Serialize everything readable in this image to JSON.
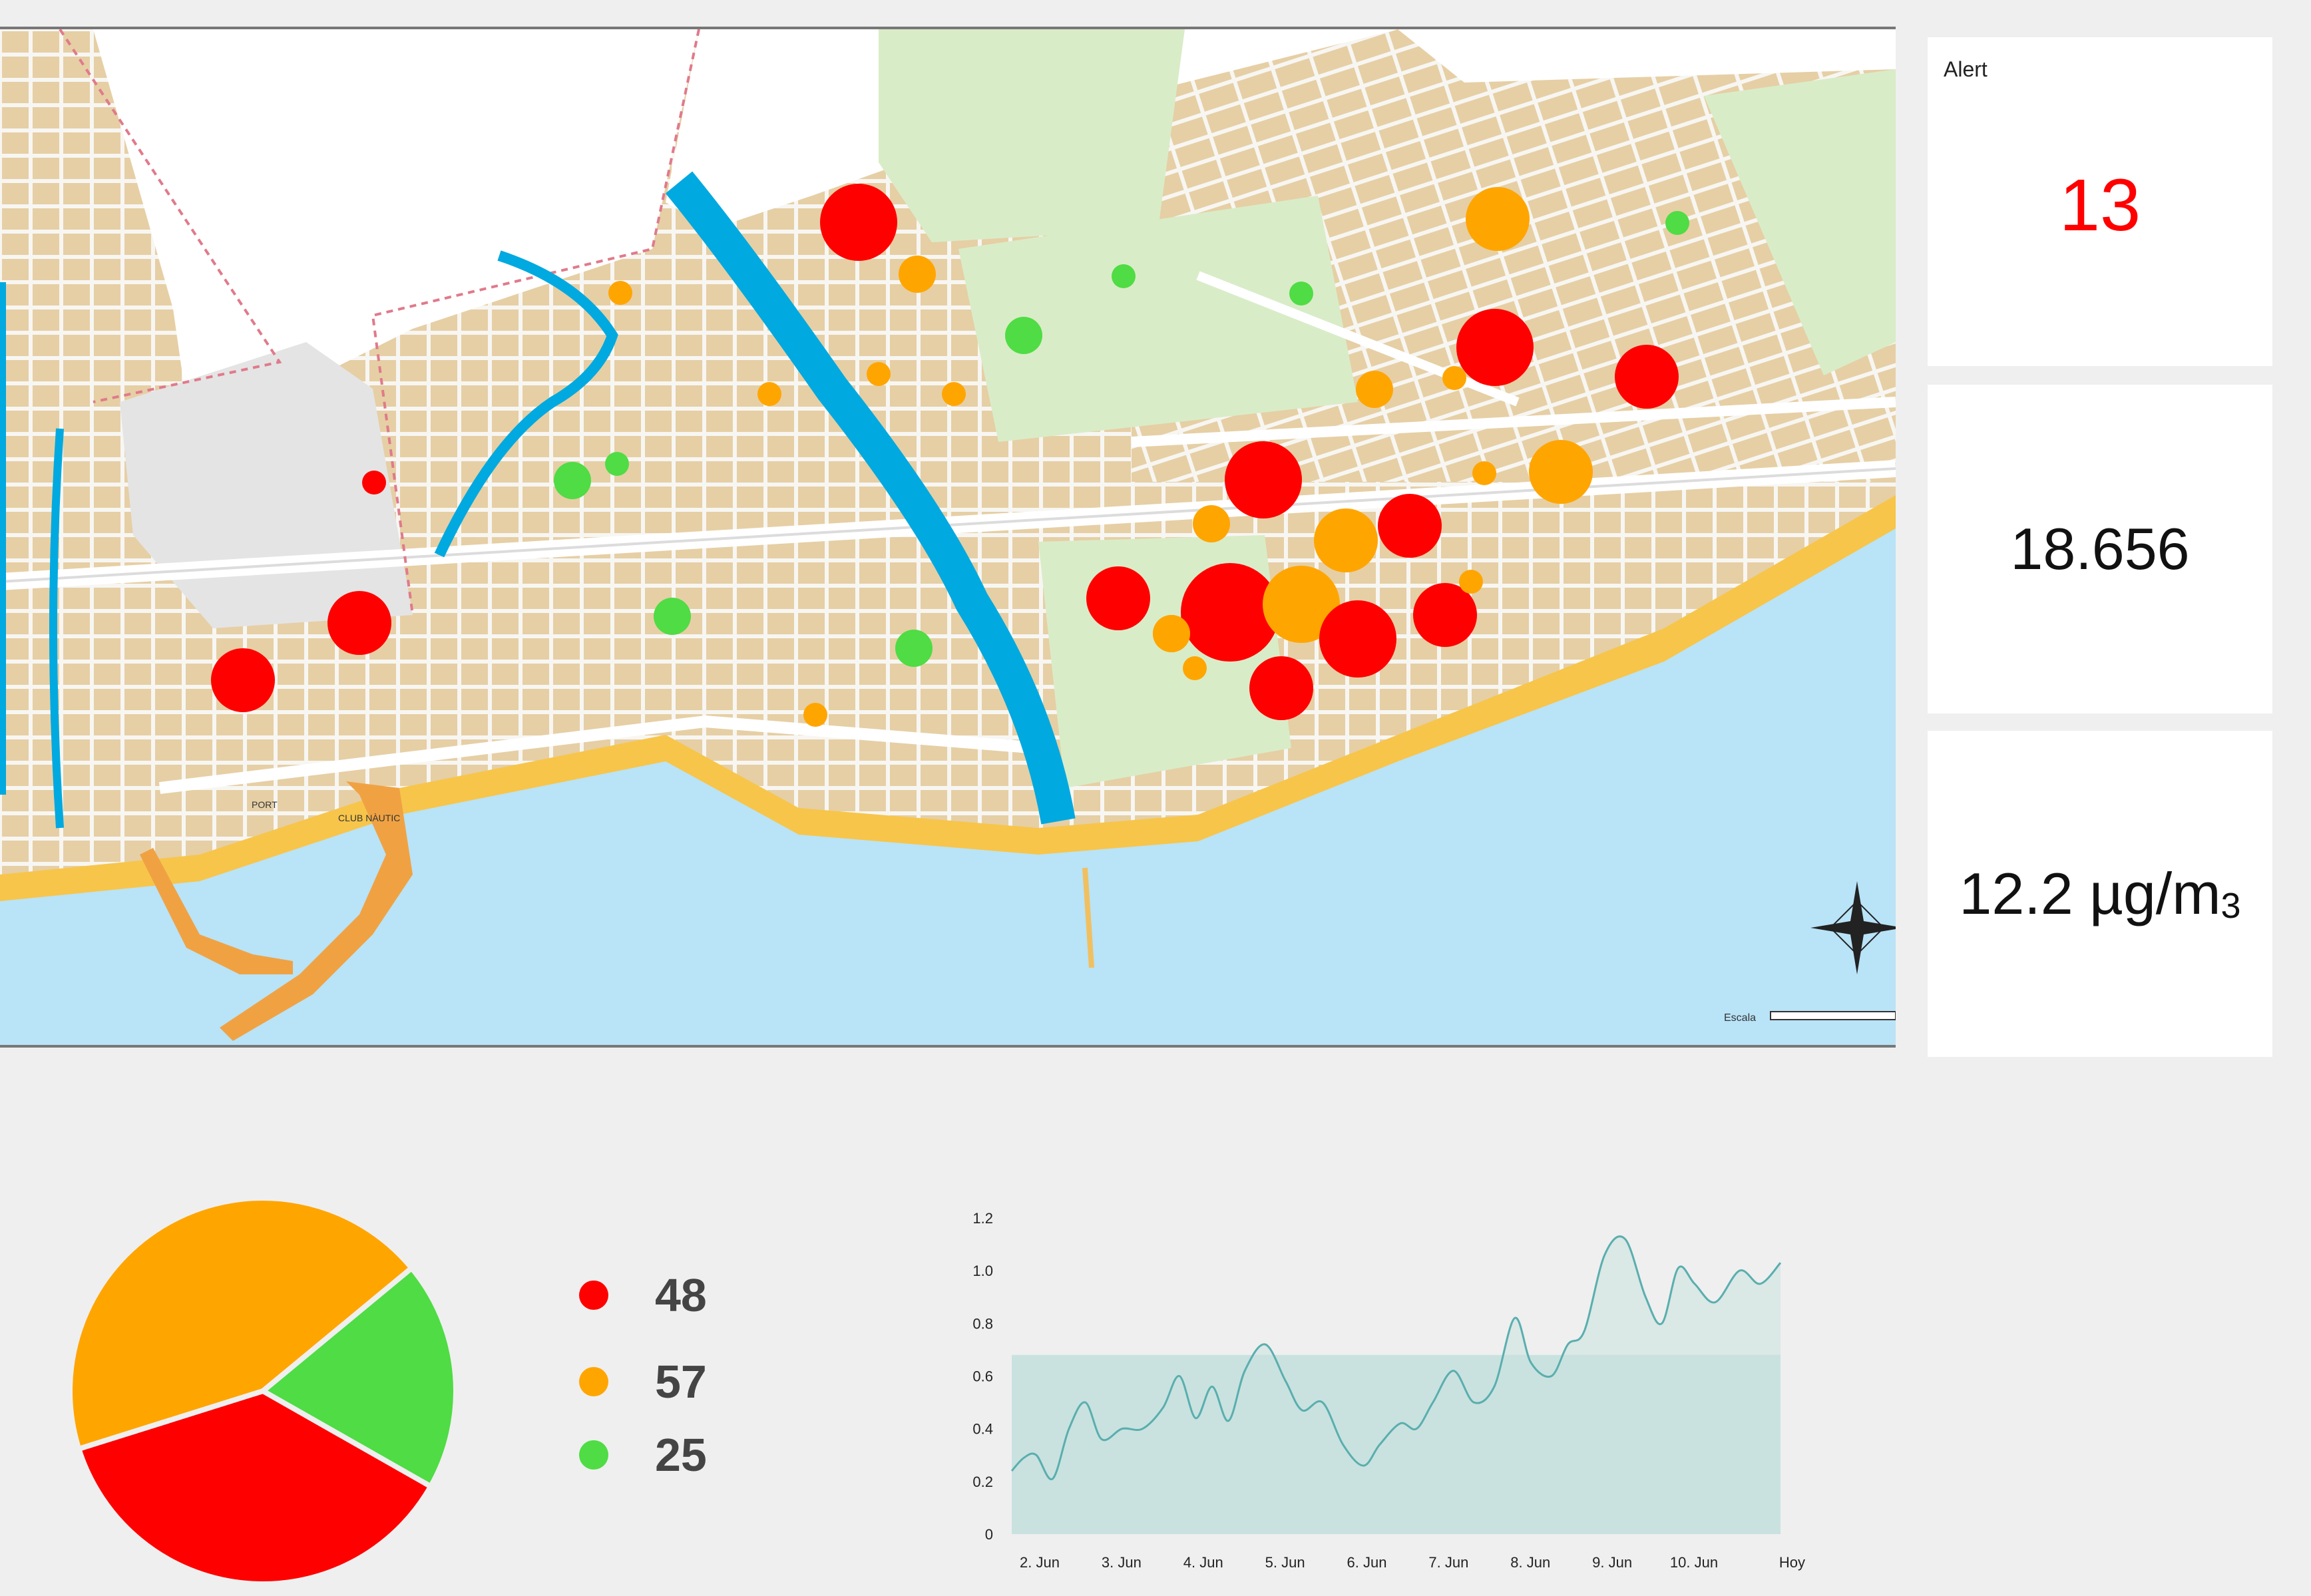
{
  "map": {
    "labels": {
      "port": "PORT",
      "club_nautic": "CLUB NÀUTIC",
      "scale": "Escala"
    },
    "colors": {
      "red": "#ff0000",
      "orange": "#ffa500",
      "green": "#4fdc44",
      "sea": "#b9e3f7",
      "beach": "#f7c54a",
      "river": "#00a9e0",
      "block": "#e6cfa5",
      "park": "#d9ecc8"
    },
    "markers": [
      {
        "level": "red",
        "size": "xl"
      },
      {
        "level": "orange",
        "size": "m"
      },
      {
        "level": "orange",
        "size": "s"
      },
      {
        "level": "green",
        "size": "m"
      },
      {
        "level": "green",
        "size": "s"
      },
      {
        "level": "green",
        "size": "s"
      },
      {
        "level": "orange",
        "size": "l"
      },
      {
        "level": "green",
        "size": "s"
      },
      {
        "level": "red",
        "size": "xl"
      },
      {
        "level": "red",
        "size": "l"
      },
      {
        "level": "orange",
        "size": "m"
      },
      {
        "level": "orange",
        "size": "s"
      },
      {
        "level": "orange",
        "size": "s"
      },
      {
        "level": "green",
        "size": "s"
      },
      {
        "level": "orange",
        "size": "s"
      },
      {
        "level": "red",
        "size": "xl"
      },
      {
        "level": "orange",
        "size": "m"
      },
      {
        "level": "orange",
        "size": "l"
      },
      {
        "level": "red",
        "size": "l"
      },
      {
        "level": "orange",
        "size": "s"
      },
      {
        "level": "orange",
        "size": "l"
      },
      {
        "level": "red",
        "size": "l"
      },
      {
        "level": "red",
        "size": "xxl"
      },
      {
        "level": "orange",
        "size": "xl"
      },
      {
        "level": "red",
        "size": "xl"
      },
      {
        "level": "red",
        "size": "l"
      },
      {
        "level": "orange",
        "size": "m"
      },
      {
        "level": "orange",
        "size": "s"
      },
      {
        "level": "red",
        "size": "l"
      },
      {
        "level": "orange",
        "size": "s"
      },
      {
        "level": "green",
        "size": "m"
      },
      {
        "level": "red",
        "size": "s"
      },
      {
        "level": "red",
        "size": "l"
      },
      {
        "level": "red",
        "size": "l"
      },
      {
        "level": "green",
        "size": "m"
      },
      {
        "level": "orange",
        "size": "s"
      },
      {
        "level": "green",
        "size": "m"
      },
      {
        "level": "orange",
        "size": "s"
      },
      {
        "level": "orange",
        "size": "m"
      }
    ]
  },
  "cards": {
    "alert_label": "Alert",
    "alert_value": "13",
    "count_value": "18.656",
    "pm_value": "12.2 µg/m",
    "pm_unit_sub": "3"
  },
  "chart_data": [
    {
      "type": "pie",
      "slices": [
        {
          "label": "48",
          "value": 48,
          "color": "#ff0000"
        },
        {
          "label": "57",
          "value": 57,
          "color": "#ffa500"
        },
        {
          "label": "25",
          "value": 25,
          "color": "#4fdc44"
        }
      ]
    },
    {
      "type": "line",
      "categories": [
        "2. Jun",
        "3. Jun",
        "4. Jun",
        "5. Jun",
        "6. Jun",
        "7. Jun",
        "8. Jun",
        "9. Jun",
        "10. Jun",
        "Hoy"
      ],
      "ylim": [
        0,
        1.2
      ],
      "yticks": [
        "0",
        "0.2",
        "0.4",
        "0.6",
        "0.8",
        "1.0",
        "1.2"
      ],
      "threshold": 0.68,
      "series": [
        {
          "x": [
            0,
            0.15,
            0.3,
            0.5,
            0.7,
            0.9,
            1.1,
            1.35,
            1.6,
            1.85,
            2.05,
            2.25,
            2.45,
            2.65,
            2.85,
            3.1,
            3.35,
            3.55,
            3.8,
            4.05,
            4.3,
            4.5,
            4.75,
            4.95,
            5.15,
            5.4,
            5.65,
            5.9,
            6.15,
            6.35,
            6.6,
            6.8,
            7.0,
            7.25,
            7.5,
            7.75,
            7.95,
            8.15,
            8.35,
            8.6,
            8.9,
            9.15,
            9.4
          ],
          "y": [
            0.24,
            0.29,
            0.3,
            0.21,
            0.4,
            0.5,
            0.36,
            0.4,
            0.4,
            0.48,
            0.6,
            0.44,
            0.56,
            0.43,
            0.62,
            0.72,
            0.58,
            0.47,
            0.5,
            0.34,
            0.26,
            0.34,
            0.42,
            0.4,
            0.5,
            0.62,
            0.5,
            0.56,
            0.82,
            0.65,
            0.6,
            0.72,
            0.77,
            1.06,
            1.12,
            0.9,
            0.8,
            1.01,
            0.95,
            0.88,
            1.0,
            0.95,
            1.03
          ]
        }
      ],
      "colors": {
        "line": "#5aaeae",
        "fill": "#c9e2df"
      }
    }
  ]
}
